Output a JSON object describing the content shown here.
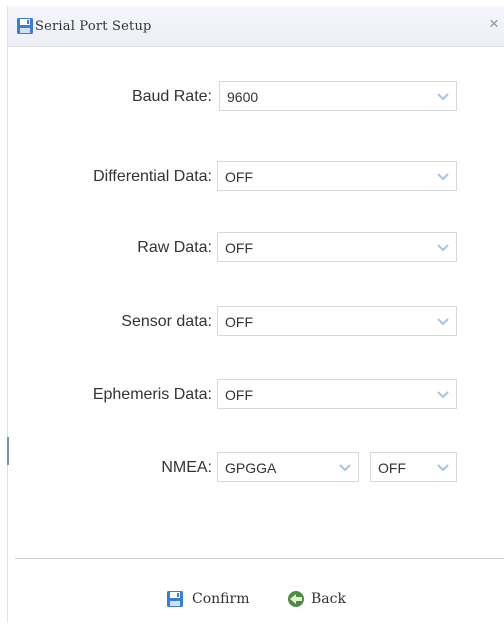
{
  "window": {
    "title": "Serial Port Setup",
    "close_glyph": "×"
  },
  "fields": {
    "baud_rate": {
      "label": "Baud Rate:",
      "value": "9600"
    },
    "differential_data": {
      "label": "Differential Data:",
      "value": "OFF"
    },
    "raw_data": {
      "label": "Raw Data:",
      "value": "OFF"
    },
    "sensor_data": {
      "label": "Sensor data:",
      "value": "OFF"
    },
    "ephemeris_data": {
      "label": "Ephemeris Data:",
      "value": "OFF"
    },
    "nmea": {
      "label": "NMEA:",
      "sentence_value": "GPGGA",
      "state_value": "OFF"
    }
  },
  "footer": {
    "confirm_label": "Confirm",
    "back_label": "Back"
  },
  "icons": {
    "title": "floppy-disk-icon",
    "close": "close-icon",
    "dropdown": "chevron-down-icon",
    "confirm": "floppy-disk-icon",
    "back": "back-arrow-icon"
  },
  "colors": {
    "accent_blue": "#3a7fd5",
    "chevron": "#a8c3e6",
    "border": "#d9d9d9"
  }
}
